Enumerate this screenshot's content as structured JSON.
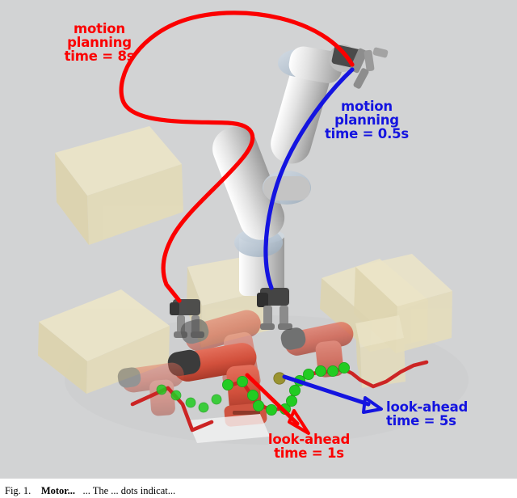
{
  "figure": {
    "background_color": "#d2d3d4",
    "annotations": {
      "motion_planning_red": "motion\nplanning\ntime = 8s",
      "motion_planning_blue": "motion\nplanning\ntime = 0.5s",
      "look_ahead_red": "look-ahead\ntime = 1s",
      "look_ahead_blue": "look-ahead\ntime = 5s"
    },
    "colors": {
      "red": "#fb0000",
      "blue": "#1414e0",
      "green_dot": "#22cc22",
      "box_cream": "#ece4c6",
      "robot_gray": "#c9c9c9",
      "drill_red": "#d4503f"
    },
    "scene": {
      "robot_arm": "ur-style 6-axis manipulator with parallel-jaw gripper",
      "objects": [
        "cream-box",
        "cream-box",
        "cream-box",
        "cream-box",
        "cream-box",
        "cordless-drill",
        "cordless-drill",
        "cordless-drill"
      ],
      "paths": [
        {
          "name": "red-motion-planning-path",
          "color": "#fb0000",
          "style": "smooth-curve"
        },
        {
          "name": "blue-motion-planning-path",
          "color": "#1414e0",
          "style": "smooth-curve"
        },
        {
          "name": "red-look-ahead-zigzag",
          "color": "#cc2020",
          "style": "zigzag"
        },
        {
          "name": "green-waypoint-dots",
          "color": "#22cc22",
          "style": "dots",
          "count": 18
        }
      ],
      "arrows": [
        {
          "name": "red-look-ahead-arrow",
          "color": "#fb0000"
        },
        {
          "name": "blue-look-ahead-arrow",
          "color": "#1414e0"
        }
      ]
    }
  },
  "caption": {
    "label": "Fig. 1.",
    "title": "Motor...",
    "text": "... The ... dots indicat..."
  }
}
